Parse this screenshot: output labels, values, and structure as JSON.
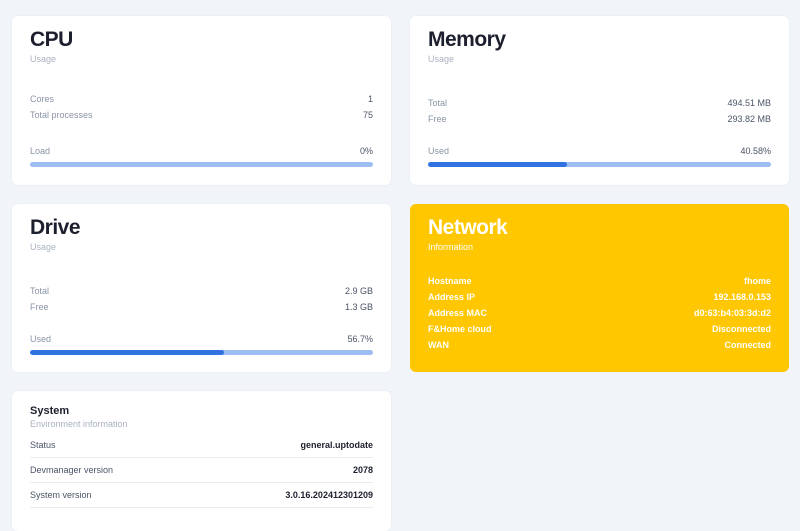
{
  "cpu": {
    "title": "CPU",
    "subtitle": "Usage",
    "rows": [
      {
        "label": "Cores",
        "value": "1"
      },
      {
        "label": "Total processes",
        "value": "75"
      }
    ],
    "bar_label": "Load",
    "bar_value": "0%",
    "bar_fraction": 0.0
  },
  "memory": {
    "title": "Memory",
    "subtitle": "Usage",
    "rows": [
      {
        "label": "Total",
        "value": "494.51 MB"
      },
      {
        "label": "Free",
        "value": "293.82 MB"
      }
    ],
    "bar_label": "Used",
    "bar_value": "40.58%",
    "bar_fraction": 0.4058
  },
  "drive": {
    "title": "Drive",
    "subtitle": "Usage",
    "rows": [
      {
        "label": "Total",
        "value": "2.9 GB"
      },
      {
        "label": "Free",
        "value": "1.3 GB"
      }
    ],
    "bar_label": "Used",
    "bar_value": "56.7%",
    "bar_fraction": 0.567
  },
  "network": {
    "title": "Network",
    "subtitle": "Information",
    "rows": [
      {
        "label": "Hostname",
        "value": "fhome"
      },
      {
        "label": "Address IP",
        "value": "192.168.0.153"
      },
      {
        "label": "Address MAC",
        "value": "d0:63:b4:03:3d:d2"
      },
      {
        "label": "F&Home cloud",
        "value": "Disconnected"
      },
      {
        "label": "WAN",
        "value": "Connected"
      }
    ],
    "color": "#ffc700"
  },
  "system": {
    "title": "System",
    "subtitle": "Environment information",
    "rows": [
      {
        "label": "Status",
        "value": "general.uptodate"
      },
      {
        "label": "Devmanager version",
        "value": "2078"
      },
      {
        "label": "System version",
        "value": "3.0.16.202412301209"
      }
    ]
  },
  "colors": {
    "background": "#f1f4f8",
    "bar_fill": "#2f72e0",
    "bar_track": "#9dbdf3"
  }
}
